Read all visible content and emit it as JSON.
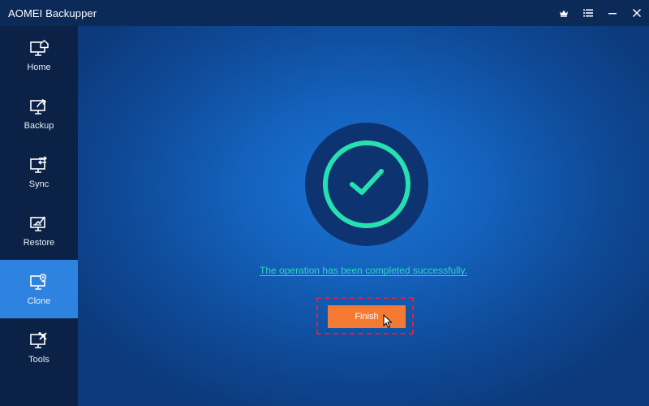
{
  "window": {
    "title": "AOMEI Backupper",
    "controls": [
      "crown-icon",
      "menu-icon",
      "minimize-icon",
      "close-icon"
    ]
  },
  "sidebar": {
    "items": [
      {
        "label": "Home",
        "icon": "home-icon",
        "active": false
      },
      {
        "label": "Backup",
        "icon": "backup-icon",
        "active": false
      },
      {
        "label": "Sync",
        "icon": "sync-icon",
        "active": false
      },
      {
        "label": "Restore",
        "icon": "restore-icon",
        "active": false
      },
      {
        "label": "Clone",
        "icon": "clone-icon",
        "active": true
      },
      {
        "label": "Tools",
        "icon": "tools-icon",
        "active": false
      }
    ]
  },
  "main": {
    "status_icon": "check-icon",
    "message": "The operation has been completed successfully.",
    "finish_label": "Finish"
  },
  "colors": {
    "accent_teal": "#27e0b1",
    "finish_orange": "#f47a33",
    "active_nav": "#2e83e0",
    "highlight_red": "#e0203a"
  }
}
